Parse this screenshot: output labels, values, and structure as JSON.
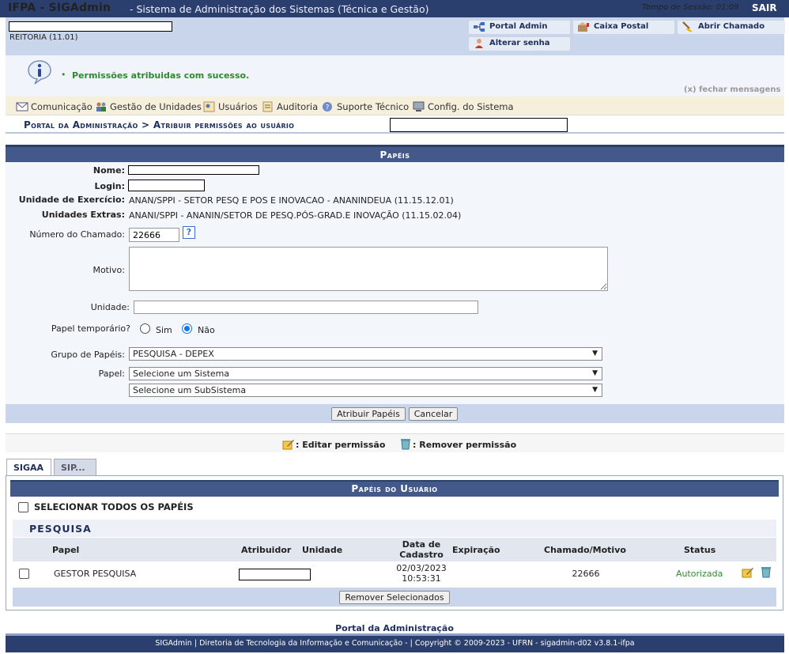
{
  "topbar": {
    "app_title": "IFPA - SIGAdmin",
    "app_subtitle": "- Sistema de Administração dos Sistemas (Técnica e Gestão)",
    "session_label": "Tempo de Sessão: 01:09",
    "logout": "SAIR"
  },
  "header": {
    "unit": "REITORIA (11.01)",
    "buttons": {
      "portal_admin": "Portal Admin",
      "caixa_postal": "Caixa Postal",
      "abrir_chamado": "Abrir Chamado",
      "alterar_senha": "Alterar senha"
    }
  },
  "messages": {
    "bullet": "•",
    "success": "Permissões atribuidas com sucesso.",
    "close": "(x) fechar mensagens"
  },
  "menu": {
    "comunicacao": "Comunicação",
    "gestao_unidades": "Gestão de Unidades",
    "usuarios": "Usuários",
    "auditoria": "Auditoria",
    "suporte": "Suporte Técnico",
    "config": "Config. do Sistema"
  },
  "breadcrumb": "Portal da Administração > Atribuir permissões ao usuário",
  "form": {
    "title": "Papéis",
    "labels": {
      "nome": "Nome:",
      "login": "Login:",
      "unidade_exercicio": "Unidade de Exercício:",
      "unidades_extras": "Unidades Extras:",
      "numero_chamado": "Número do Chamado:",
      "motivo": "Motivo:",
      "unidade": "Unidade:",
      "papel_temporario": "Papel temporário?",
      "grupo_papeis": "Grupo de Papéis:",
      "papel": "Papel:"
    },
    "values": {
      "unidade_exercicio": "ANAN/SPPI - SETOR PESQ E POS E INOVACAO - ANANINDEUA (11.15.12.01)",
      "unidades_extras": "ANANI/SPPI - ANANIN/SETOR DE PESQ.PÓS-GRAD.E INOVAÇÃO (11.15.02.04)",
      "numero_chamado": "22666",
      "help": "?"
    },
    "radio": {
      "sim": "Sim",
      "nao": "Não",
      "selected": "nao"
    },
    "selects": {
      "grupo_papeis": "PESQUISA - DEPEX",
      "papel_sistema": "Selecione um Sistema",
      "papel_subsistema": "Selecione um SubSistema"
    },
    "buttons": {
      "atribuir": "Atribuir Papéis",
      "cancelar": "Cancelar"
    }
  },
  "legend": {
    "editar": ": Editar permissão",
    "remover": ": Remover permissão"
  },
  "tabs": [
    {
      "label": "SIGAA",
      "active": true
    },
    {
      "label": "SIP...",
      "active": false
    }
  ],
  "roles_panel": {
    "title": "Papéis do Usuário",
    "select_all": "SELECIONAR TODOS OS PAPÉIS",
    "group": "PESQUISA",
    "columns": {
      "papel": "Papel",
      "atribuidor": "Atribuidor",
      "unidade": "Unidade",
      "data_cadastro_1": "Data de",
      "data_cadastro_2": "Cadastro",
      "expiracao": "Expiração",
      "chamado_motivo": "Chamado/Motivo",
      "status": "Status"
    },
    "rows": [
      {
        "papel": "GESTOR PESQUISA",
        "data": "02/03/2023",
        "hora": "10:53:31",
        "chamado": "22666",
        "status": "Autorizada"
      }
    ],
    "remove_button": "Remover Selecionados"
  },
  "footer": {
    "link": "Portal da Administração",
    "copyright": "SIGAdmin | Diretoria de Tecnologia da Informação e Comunicação - | Copyright © 2009-2023 - UFRN - sigadmin-d02 v3.8.1-ifpa"
  },
  "colors": {
    "topbar": "#2a3f6e",
    "section_header": "#42598a",
    "success_text": "#2d8b2d"
  }
}
